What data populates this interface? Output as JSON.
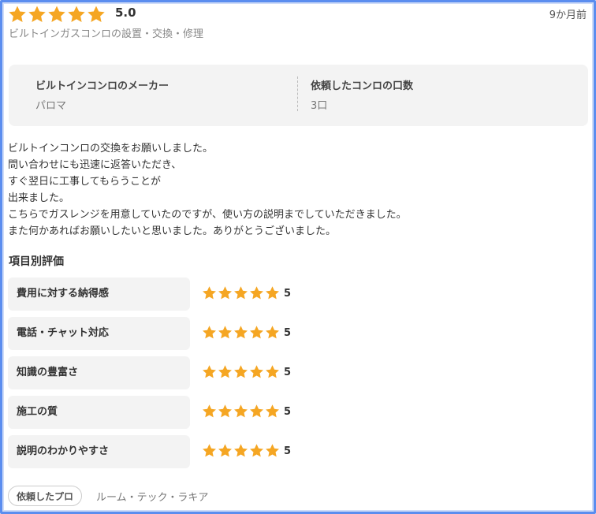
{
  "review": {
    "rating": 5,
    "rating_text": "5.0",
    "time_ago": "9か月前",
    "service": "ビルトインガスコンロの設置・交換・修理"
  },
  "info": {
    "maker_label": "ビルトインコンロのメーカー",
    "maker_value": "パロマ",
    "count_label": "依頼したコンロの口数",
    "count_value": "3口"
  },
  "body_lines": [
    "ビルトインコンロの交換をお願いしました。",
    "問い合わせにも迅速に返答いただき、",
    "すぐ翌日に工事してもらうことが",
    "出来ました。",
    "こちらでガスレンジを用意していたのですが、使い方の説明までしていただきました。",
    "また何かあればお願いしたいと思いました。ありがとうございました。"
  ],
  "categories_title": "項目別評価",
  "categories": [
    {
      "label": "費用に対する納得感",
      "score": "5",
      "stars": 5
    },
    {
      "label": "電話・チャット対応",
      "score": "5",
      "stars": 5
    },
    {
      "label": "知識の豊富さ",
      "score": "5",
      "stars": 5
    },
    {
      "label": "施工の質",
      "score": "5",
      "stars": 5
    },
    {
      "label": "説明のわかりやすさ",
      "score": "5",
      "stars": 5
    }
  ],
  "pro": {
    "badge_label": "依頼したプロ",
    "name": "ルーム・テック・ラキア"
  },
  "colors": {
    "star": "#f5a623",
    "frame": "#5b8def"
  },
  "icons": {
    "star": "star-icon"
  }
}
